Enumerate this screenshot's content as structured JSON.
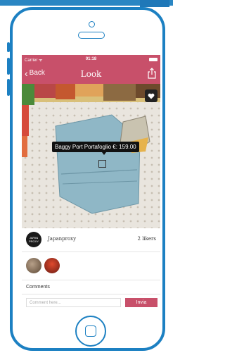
{
  "status_bar": {
    "carrier": "Carrier ᯤ",
    "time": "01:18"
  },
  "nav": {
    "back_label": "Back",
    "title": "Look"
  },
  "photo": {
    "tag_label": "Baggy Port Portafoglio €: 159.00",
    "subject": "light blue leather wallet on patterned fabric"
  },
  "owner": {
    "name": "Japanproxy",
    "avatar_text": "JAPAN PROXY",
    "likers": "2 likers"
  },
  "comments": {
    "label": "Comments",
    "placeholder": "Comment here...",
    "send_label": "Invia"
  },
  "colors": {
    "accent": "#c8506a",
    "frame": "#1c80c2"
  },
  "icons": [
    "chevron-left-icon",
    "share-icon",
    "heart-icon",
    "home-button-icon"
  ]
}
